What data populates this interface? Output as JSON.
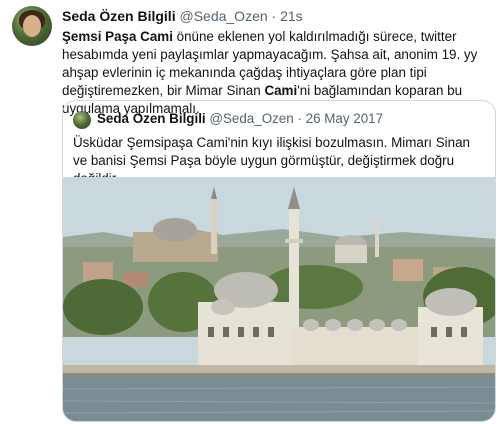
{
  "tweet": {
    "author_name": "Seda Özen Bilgili",
    "handle": "@Seda_Ozen",
    "separator": "·",
    "time": "21s",
    "text_bold_1": "Şemsi Paşa Cami",
    "text_1": " önüne eklenen yol kaldırılmadığı sürece, twitter hesabımda yeni paylaşımlar yapmayacağım. Şahsa ait, anonim 19. yy ahşap evlerinin iç mekanında çağdaş ihtiyaçlara göre plan tipi değiştiremezken, bir Mimar Sinan ",
    "text_bold_2": "Cami",
    "text_2": "'ni bağlamından koparan bu uygulama yapılmamalı."
  },
  "quoted": {
    "author_name": "Seda Özen Bilgili",
    "handle": "@Seda_Ozen",
    "separator": "·",
    "date": "26 May 2017",
    "text": "Üsküdar Şemsipaşa Cami'nin kıyı ilişkisi bozulmasın. Mimarı Sinan ve banisi Şemsi Paşa böyle uygun görmüştür, değiştirmek doğru değildir."
  },
  "colors": {
    "text": "#0f1419",
    "muted": "#536471",
    "border": "#cfd9de",
    "sky": "#c6d6dc",
    "water": "#7a8d92"
  },
  "photo_subject": "mosque-on-shore-photo"
}
